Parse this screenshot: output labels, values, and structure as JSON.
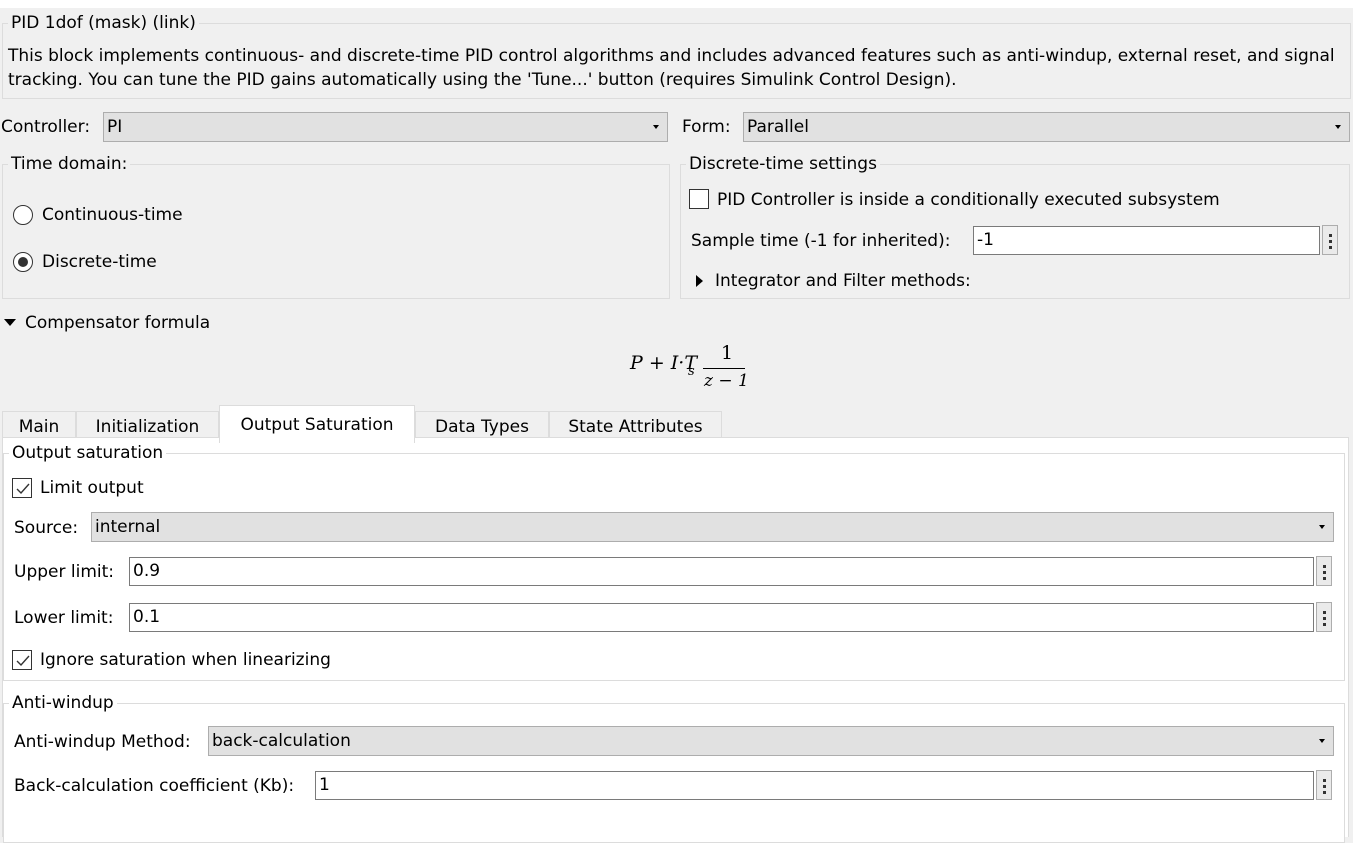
{
  "block": {
    "title": "PID 1dof (mask) (link)",
    "description": "This block implements continuous- and discrete-time PID control algorithms and includes advanced features such as anti-windup, external reset, and signal tracking. You can tune the PID gains automatically using the 'Tune...' button (requires Simulink Control Design)."
  },
  "controller": {
    "label": "Controller:",
    "value": "PI"
  },
  "form": {
    "label": "Form:",
    "value": "Parallel"
  },
  "time_domain": {
    "title": "Time domain:",
    "options": [
      {
        "label": "Continuous-time",
        "selected": false
      },
      {
        "label": "Discrete-time",
        "selected": true
      }
    ]
  },
  "discrete_settings": {
    "title": "Discrete-time settings",
    "conditional_checkbox": {
      "label": "PID Controller is inside a conditionally executed subsystem",
      "checked": false
    },
    "sample_time": {
      "label": "Sample time (-1 for inherited):",
      "value": "-1"
    },
    "integrator_methods": {
      "label": "Integrator and Filter methods:",
      "expanded": false
    }
  },
  "compensator": {
    "label": "Compensator formula",
    "expanded": true,
    "formula": {
      "lhs": "P + I·T",
      "sub": "s",
      "numerator": "1",
      "denominator": "z − 1"
    }
  },
  "tabs": [
    {
      "label": "Main",
      "active": false
    },
    {
      "label": "Initialization",
      "active": false
    },
    {
      "label": "Output Saturation",
      "active": true
    },
    {
      "label": "Data Types",
      "active": false
    },
    {
      "label": "State Attributes",
      "active": false
    }
  ],
  "output_saturation": {
    "title": "Output saturation",
    "limit_output": {
      "label": "Limit output",
      "checked": true
    },
    "source": {
      "label": "Source:",
      "value": "internal"
    },
    "upper_limit": {
      "label": "Upper limit:",
      "value": "0.9"
    },
    "lower_limit": {
      "label": "Lower limit:",
      "value": "0.1"
    },
    "ignore_saturation": {
      "label": "Ignore saturation when linearizing",
      "checked": true
    }
  },
  "anti_windup": {
    "title": "Anti-windup",
    "method": {
      "label": "Anti-windup Method:",
      "value": "back-calculation"
    },
    "kb": {
      "label": "Back-calculation coefficient (Kb):",
      "value": "1"
    }
  }
}
